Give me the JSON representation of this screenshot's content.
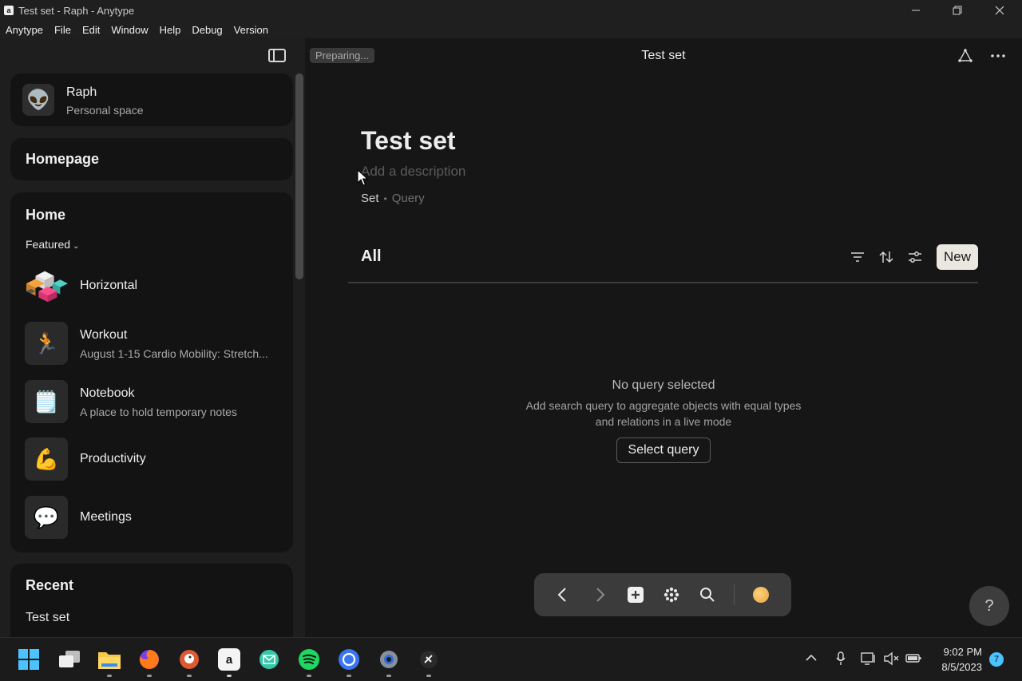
{
  "window": {
    "title": "Test set - Raph - Anytype",
    "app_icon_text": "a"
  },
  "menu": [
    "Anytype",
    "File",
    "Edit",
    "Window",
    "Help",
    "Debug",
    "Version"
  ],
  "sidebar": {
    "space": {
      "name": "Raph",
      "type": "Personal space",
      "avatar": "alien-emoji"
    },
    "homepage_label": "Homepage",
    "home": {
      "title": "Home",
      "featured_label": "Featured",
      "items": [
        {
          "title": "Horizontal",
          "description": "",
          "icon": "colored-blocks-icon"
        },
        {
          "title": "Workout",
          "description": "August 1-15 Cardio Mobility: Stretch...",
          "icon": "runner-emoji"
        },
        {
          "title": "Notebook",
          "description": "A place to hold temporary notes",
          "icon": "notepad-emoji"
        },
        {
          "title": "Productivity",
          "description": "",
          "icon": "flexed-arm-emoji"
        },
        {
          "title": "Meetings",
          "description": "",
          "icon": "speech-bubble-emoji"
        }
      ]
    },
    "recent": {
      "title": "Recent",
      "items": [
        "Test set"
      ]
    }
  },
  "main": {
    "status": "Preparing...",
    "header_title": "Test set",
    "page": {
      "title": "Test set",
      "description_placeholder": "Add a description",
      "type": "Set",
      "relation": "Query"
    },
    "view": {
      "tab": "All",
      "new_button": "New"
    },
    "empty_state": {
      "title": "No query selected",
      "description": "Add search query to aggregate objects with equal types and relations in a live mode",
      "button": "Select query"
    },
    "help": "?"
  },
  "taskbar": {
    "time": "9:02 PM",
    "date": "8/5/2023",
    "notifications": "7"
  },
  "colors": {
    "background": "#161616",
    "sidebar": "#1e1e1e",
    "new_button": "#e9e7df",
    "notification": "#4cc2ff"
  }
}
